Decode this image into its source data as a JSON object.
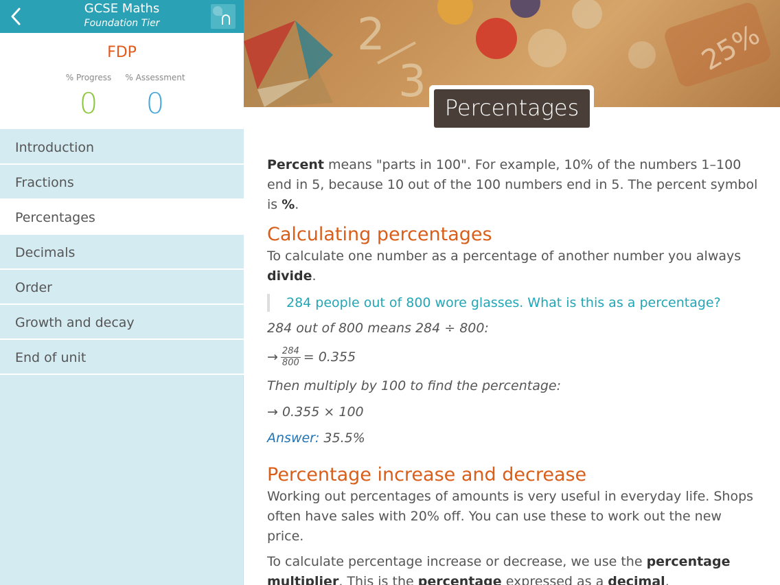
{
  "header": {
    "title": "GCSE Maths",
    "subtitle": "Foundation Tier",
    "back_icon": "chevron-left-icon",
    "lock_icon": "puzzle-lock-icon"
  },
  "summary": {
    "unit": "FDP",
    "progress_label": "% Progress",
    "assessment_label": "% Assessment",
    "progress_value": "0",
    "assessment_value": "0"
  },
  "nav": {
    "items": [
      {
        "label": "Introduction"
      },
      {
        "label": "Fractions"
      },
      {
        "label": "Percentages"
      },
      {
        "label": "Decimals"
      },
      {
        "label": "Order"
      },
      {
        "label": "Growth and decay"
      },
      {
        "label": "End of unit"
      }
    ],
    "active": "Percentages"
  },
  "banner": {
    "title": "Percentages"
  },
  "content": {
    "intro_bold": "Percent",
    "intro_text1": " means \"parts in 100\". For example, 10% of the numbers 1–100 end in 5, because 10 out of the 100 numbers end in 5. The percent symbol is ",
    "intro_symbol": "%",
    "intro_end": ".",
    "h_calc": "Calculating percentages",
    "calc_text": "To calculate one number as a percentage of another number you always ",
    "calc_bold": "divide",
    "calc_end": ".",
    "question": "284 people out of 800 wore glasses. What is this as a percentage?",
    "step1": "284 out of 800 means 284 ÷ 800:",
    "step2_arrow": "→",
    "frac_num": "284",
    "frac_den": "800",
    "step2_result": "= 0.355",
    "step3": "Then multiply by 100 to find the percentage:",
    "step4": "→ 0.355 × 100",
    "answer_label": "Answer:",
    "answer_value": " 35.5%",
    "h_incdec": "Percentage increase and decrease",
    "incdec_text": "Working out percentages of amounts is very useful in everyday life. Shops often have sales with 20% off. You can use these to work out the new price.",
    "incdec2_a": "To calculate percentage increase or decrease, we use the ",
    "incdec2_b1": "percentage multiplier",
    "incdec2_c": ". This is the ",
    "incdec2_b2": "percentage",
    "incdec2_d": " expressed as a ",
    "incdec2_b3": "decimal",
    "incdec2_e": "."
  },
  "colors": {
    "header": "#2aa1b4",
    "accent_orange": "#d95e19",
    "progress_green": "#8dc63f",
    "assessment_blue": "#4aa7d6",
    "question_teal": "#22a6b6"
  }
}
